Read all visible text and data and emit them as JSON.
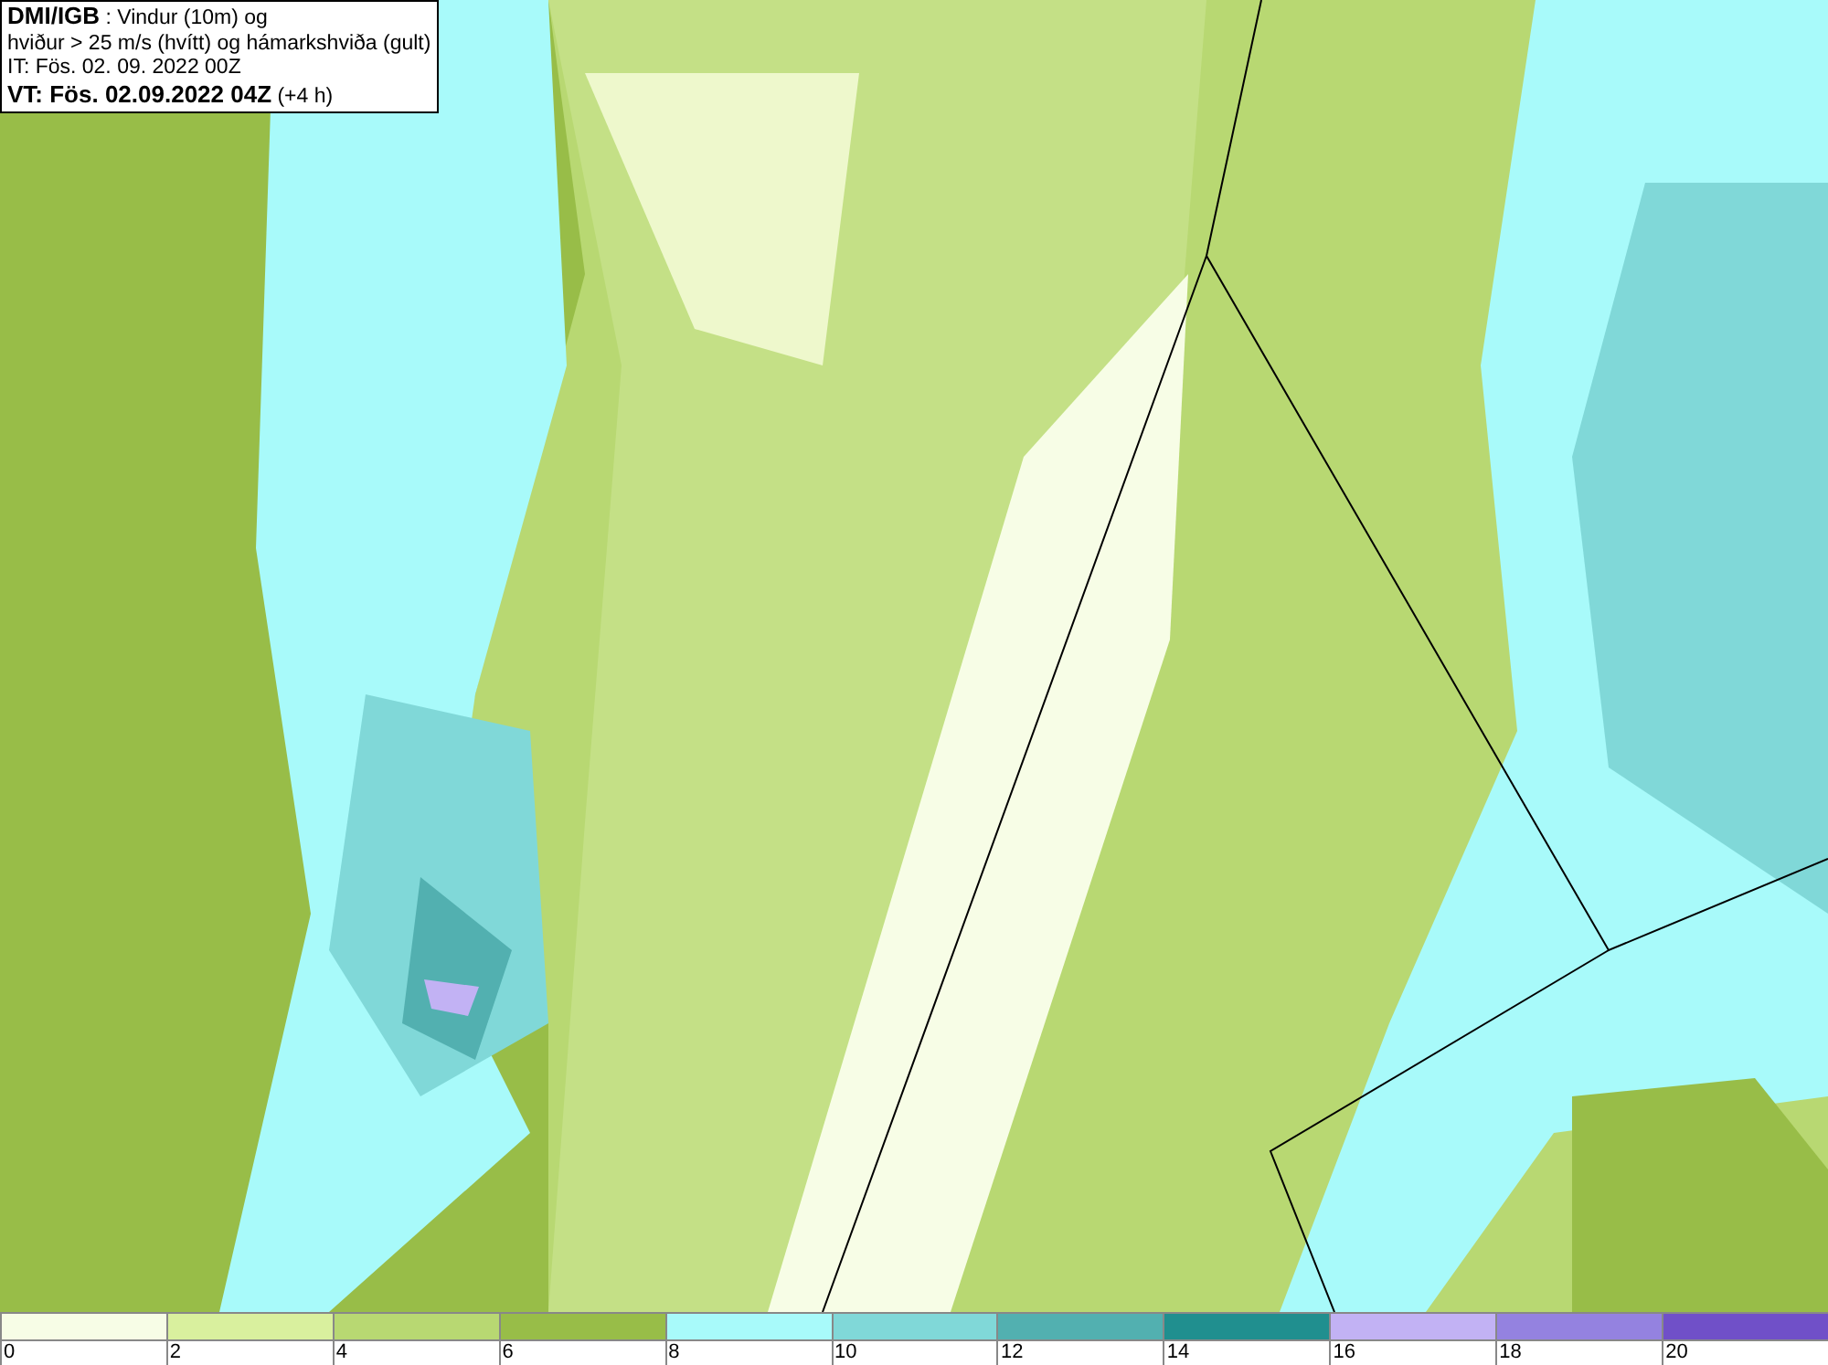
{
  "title_box": {
    "lines": [
      "**DMI/IGB** : Vindur (10m) og",
      "hviður > 25 m/s (hvítt) og hámarkshviða (gult)",
      "IT: Fös. 02. 09. 2022 00Z",
      "**VT: Fös. 02.09.2022 04Z** (+4 h)"
    ]
  },
  "legend": [
    {
      "label": "0",
      "color": "#f7fde6"
    },
    {
      "label": "2",
      "color": "#d9f09e"
    },
    {
      "label": "4",
      "color": "#b8d872"
    },
    {
      "label": "6",
      "color": "#98bd48"
    },
    {
      "label": "8",
      "color": "#a8fafa"
    },
    {
      "label": "10",
      "color": "#80d8d8"
    },
    {
      "label": "12",
      "color": "#52b0b0"
    },
    {
      "label": "14",
      "color": "#208f8f"
    },
    {
      "label": "16",
      "color": "#c2b2f4"
    },
    {
      "label": "18",
      "color": "#9482e0"
    },
    {
      "label": "20",
      "color": "#7050c8"
    }
  ]
}
